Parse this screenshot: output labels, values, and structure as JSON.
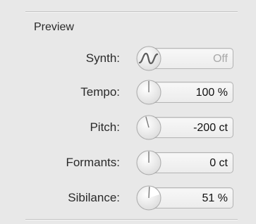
{
  "section": {
    "title": "Preview"
  },
  "rows": [
    {
      "label": "Synth:",
      "value": "Off",
      "control": "toggle",
      "icon": "waveform-icon",
      "disabled": true
    },
    {
      "label": "Tempo:",
      "value": "100 %",
      "control": "knob",
      "knob_fraction": 0.5
    },
    {
      "label": "Pitch:",
      "value": "-200 ct",
      "control": "knob",
      "knob_fraction": 0.45
    },
    {
      "label": "Formants:",
      "value": "0 ct",
      "control": "knob",
      "knob_fraction": 0.5
    },
    {
      "label": "Sibilance:",
      "value": "51 %",
      "control": "knob",
      "knob_fraction": 0.51
    }
  ],
  "colors": {
    "background": "#e8e8e8",
    "label_text": "#2a2a2a",
    "value_text": "#111111",
    "disabled_text": "#a8a8a8"
  }
}
